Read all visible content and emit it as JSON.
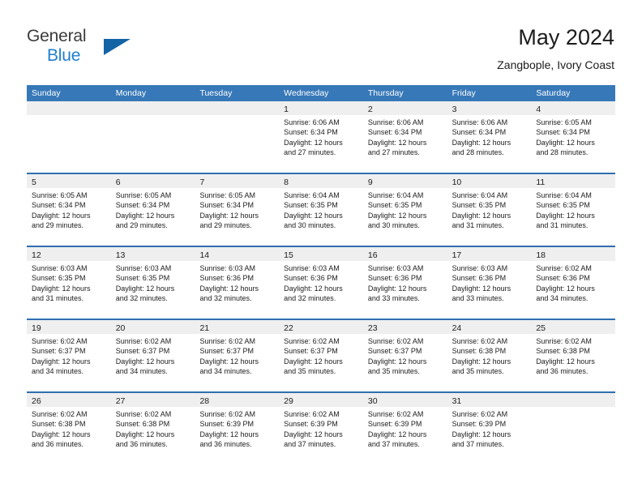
{
  "brand": {
    "name_part1": "General",
    "name_part2": "Blue"
  },
  "header": {
    "title": "May 2024",
    "subtitle": "Zangbople, Ivory Coast"
  },
  "colors": {
    "header_blue": "#3778b8",
    "row_divider_blue": "#2f6fb0",
    "day_strip_gray": "#efefef",
    "brand_blue": "#1f7fd0",
    "text": "#1c1c1c"
  },
  "weekdays": [
    "Sunday",
    "Monday",
    "Tuesday",
    "Wednesday",
    "Thursday",
    "Friday",
    "Saturday"
  ],
  "weeks": [
    [
      {
        "day": "",
        "lines": []
      },
      {
        "day": "",
        "lines": []
      },
      {
        "day": "",
        "lines": []
      },
      {
        "day": "1",
        "lines": [
          "Sunrise: 6:06 AM",
          "Sunset: 6:34 PM",
          "Daylight: 12 hours",
          "and 27 minutes."
        ]
      },
      {
        "day": "2",
        "lines": [
          "Sunrise: 6:06 AM",
          "Sunset: 6:34 PM",
          "Daylight: 12 hours",
          "and 27 minutes."
        ]
      },
      {
        "day": "3",
        "lines": [
          "Sunrise: 6:06 AM",
          "Sunset: 6:34 PM",
          "Daylight: 12 hours",
          "and 28 minutes."
        ]
      },
      {
        "day": "4",
        "lines": [
          "Sunrise: 6:05 AM",
          "Sunset: 6:34 PM",
          "Daylight: 12 hours",
          "and 28 minutes."
        ]
      }
    ],
    [
      {
        "day": "5",
        "lines": [
          "Sunrise: 6:05 AM",
          "Sunset: 6:34 PM",
          "Daylight: 12 hours",
          "and 29 minutes."
        ]
      },
      {
        "day": "6",
        "lines": [
          "Sunrise: 6:05 AM",
          "Sunset: 6:34 PM",
          "Daylight: 12 hours",
          "and 29 minutes."
        ]
      },
      {
        "day": "7",
        "lines": [
          "Sunrise: 6:05 AM",
          "Sunset: 6:34 PM",
          "Daylight: 12 hours",
          "and 29 minutes."
        ]
      },
      {
        "day": "8",
        "lines": [
          "Sunrise: 6:04 AM",
          "Sunset: 6:35 PM",
          "Daylight: 12 hours",
          "and 30 minutes."
        ]
      },
      {
        "day": "9",
        "lines": [
          "Sunrise: 6:04 AM",
          "Sunset: 6:35 PM",
          "Daylight: 12 hours",
          "and 30 minutes."
        ]
      },
      {
        "day": "10",
        "lines": [
          "Sunrise: 6:04 AM",
          "Sunset: 6:35 PM",
          "Daylight: 12 hours",
          "and 31 minutes."
        ]
      },
      {
        "day": "11",
        "lines": [
          "Sunrise: 6:04 AM",
          "Sunset: 6:35 PM",
          "Daylight: 12 hours",
          "and 31 minutes."
        ]
      }
    ],
    [
      {
        "day": "12",
        "lines": [
          "Sunrise: 6:03 AM",
          "Sunset: 6:35 PM",
          "Daylight: 12 hours",
          "and 31 minutes."
        ]
      },
      {
        "day": "13",
        "lines": [
          "Sunrise: 6:03 AM",
          "Sunset: 6:35 PM",
          "Daylight: 12 hours",
          "and 32 minutes."
        ]
      },
      {
        "day": "14",
        "lines": [
          "Sunrise: 6:03 AM",
          "Sunset: 6:36 PM",
          "Daylight: 12 hours",
          "and 32 minutes."
        ]
      },
      {
        "day": "15",
        "lines": [
          "Sunrise: 6:03 AM",
          "Sunset: 6:36 PM",
          "Daylight: 12 hours",
          "and 32 minutes."
        ]
      },
      {
        "day": "16",
        "lines": [
          "Sunrise: 6:03 AM",
          "Sunset: 6:36 PM",
          "Daylight: 12 hours",
          "and 33 minutes."
        ]
      },
      {
        "day": "17",
        "lines": [
          "Sunrise: 6:03 AM",
          "Sunset: 6:36 PM",
          "Daylight: 12 hours",
          "and 33 minutes."
        ]
      },
      {
        "day": "18",
        "lines": [
          "Sunrise: 6:02 AM",
          "Sunset: 6:36 PM",
          "Daylight: 12 hours",
          "and 34 minutes."
        ]
      }
    ],
    [
      {
        "day": "19",
        "lines": [
          "Sunrise: 6:02 AM",
          "Sunset: 6:37 PM",
          "Daylight: 12 hours",
          "and 34 minutes."
        ]
      },
      {
        "day": "20",
        "lines": [
          "Sunrise: 6:02 AM",
          "Sunset: 6:37 PM",
          "Daylight: 12 hours",
          "and 34 minutes."
        ]
      },
      {
        "day": "21",
        "lines": [
          "Sunrise: 6:02 AM",
          "Sunset: 6:37 PM",
          "Daylight: 12 hours",
          "and 34 minutes."
        ]
      },
      {
        "day": "22",
        "lines": [
          "Sunrise: 6:02 AM",
          "Sunset: 6:37 PM",
          "Daylight: 12 hours",
          "and 35 minutes."
        ]
      },
      {
        "day": "23",
        "lines": [
          "Sunrise: 6:02 AM",
          "Sunset: 6:37 PM",
          "Daylight: 12 hours",
          "and 35 minutes."
        ]
      },
      {
        "day": "24",
        "lines": [
          "Sunrise: 6:02 AM",
          "Sunset: 6:38 PM",
          "Daylight: 12 hours",
          "and 35 minutes."
        ]
      },
      {
        "day": "25",
        "lines": [
          "Sunrise: 6:02 AM",
          "Sunset: 6:38 PM",
          "Daylight: 12 hours",
          "and 36 minutes."
        ]
      }
    ],
    [
      {
        "day": "26",
        "lines": [
          "Sunrise: 6:02 AM",
          "Sunset: 6:38 PM",
          "Daylight: 12 hours",
          "and 36 minutes."
        ]
      },
      {
        "day": "27",
        "lines": [
          "Sunrise: 6:02 AM",
          "Sunset: 6:38 PM",
          "Daylight: 12 hours",
          "and 36 minutes."
        ]
      },
      {
        "day": "28",
        "lines": [
          "Sunrise: 6:02 AM",
          "Sunset: 6:39 PM",
          "Daylight: 12 hours",
          "and 36 minutes."
        ]
      },
      {
        "day": "29",
        "lines": [
          "Sunrise: 6:02 AM",
          "Sunset: 6:39 PM",
          "Daylight: 12 hours",
          "and 37 minutes."
        ]
      },
      {
        "day": "30",
        "lines": [
          "Sunrise: 6:02 AM",
          "Sunset: 6:39 PM",
          "Daylight: 12 hours",
          "and 37 minutes."
        ]
      },
      {
        "day": "31",
        "lines": [
          "Sunrise: 6:02 AM",
          "Sunset: 6:39 PM",
          "Daylight: 12 hours",
          "and 37 minutes."
        ]
      },
      {
        "day": "",
        "lines": []
      }
    ]
  ]
}
